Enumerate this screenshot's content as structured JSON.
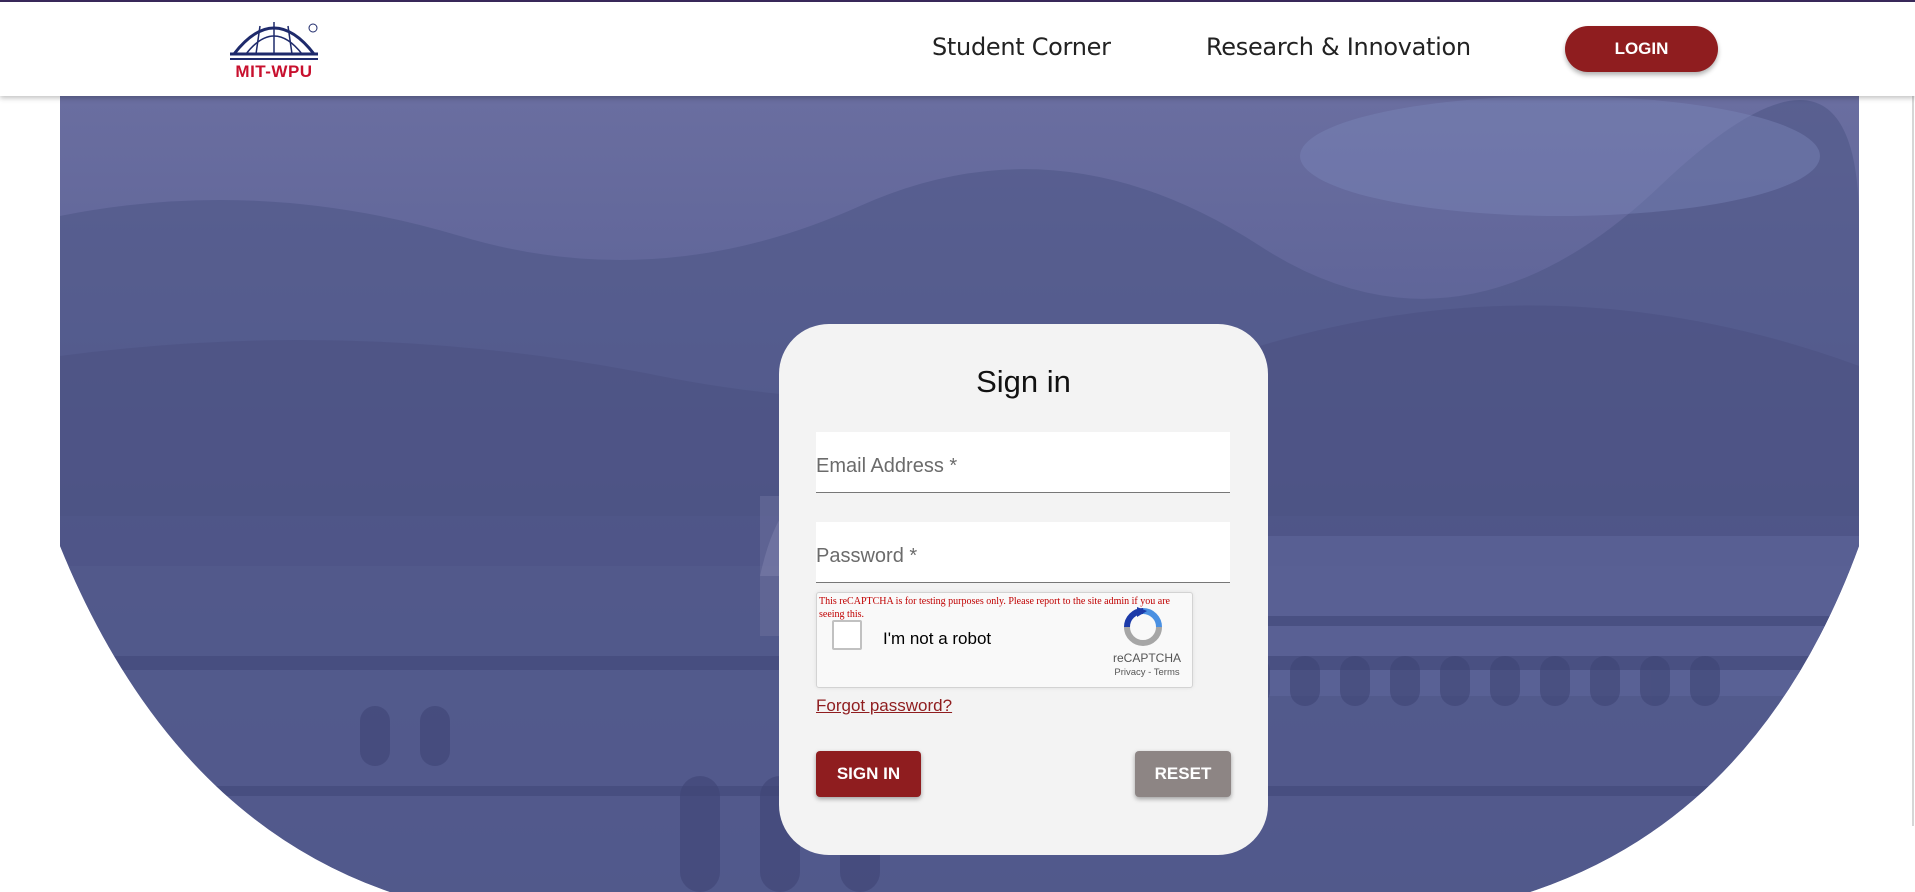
{
  "header": {
    "logo_text": "MIT-WPU",
    "nav": [
      {
        "label": "Student Corner"
      },
      {
        "label": "Research & Innovation"
      }
    ],
    "login_label": "LOGIN"
  },
  "signin": {
    "title": "Sign in",
    "email_placeholder": "Email Address *",
    "password_placeholder": "Password *",
    "recaptcha": {
      "warning": "This reCAPTCHA is for testing purposes only. Please report to the site admin if you are seeing this.",
      "checkbox_label": "I'm not a robot",
      "brand": "reCAPTCHA",
      "links": "Privacy - Terms"
    },
    "forgot_password": "Forgot password?",
    "signin_button": "SIGN IN",
    "reset_button": "RESET"
  },
  "colors": {
    "brand_red": "#8f1d1f",
    "logo_red": "#c8102e",
    "overlay_blue": "#5a6296",
    "reset_gray": "#8d8584"
  }
}
